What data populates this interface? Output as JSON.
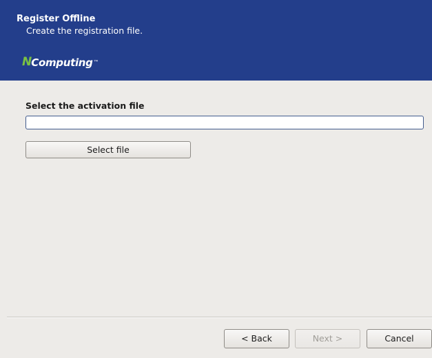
{
  "header": {
    "title": "Register Offline",
    "subtitle": "Create the registration file.",
    "logo": {
      "brand_n": "N",
      "brand_rest": "Computing",
      "trademark": "™",
      "brand_color": "#7ac143"
    },
    "background_color": "#233e8b"
  },
  "main": {
    "section_label": "Select the activation file",
    "file_input_value": "",
    "select_file_label": "Select file"
  },
  "footer": {
    "back_label": "< Back",
    "next_label": "Next >",
    "next_enabled": false,
    "cancel_label": "Cancel"
  }
}
